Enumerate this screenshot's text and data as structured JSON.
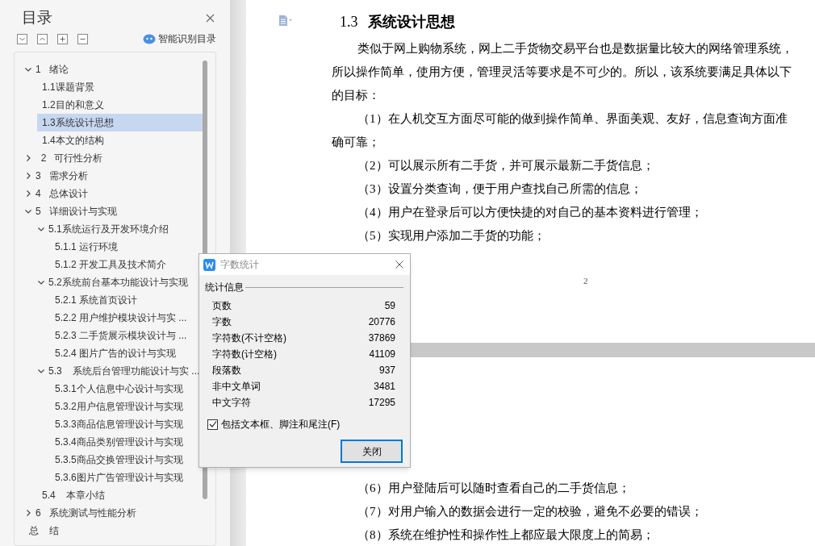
{
  "sidebar": {
    "title": "目录",
    "smart_toc": "智能识别目录",
    "toc": [
      {
        "kind": "branch",
        "label": "1   绪论",
        "expanded": true,
        "selected": false,
        "children": [
          {
            "kind": "leaf",
            "label": "1.1课题背景",
            "selected": false
          },
          {
            "kind": "leaf",
            "label": "1.2目的和意义",
            "selected": false
          },
          {
            "kind": "leaf",
            "label": "1.3系统设计思想",
            "selected": true
          },
          {
            "kind": "leaf",
            "label": "1.4本文的结构",
            "selected": false
          }
        ]
      },
      {
        "kind": "branch",
        "label": "  2   可行性分析",
        "expanded": false,
        "selected": false
      },
      {
        "kind": "branch",
        "label": "3   需求分析",
        "expanded": false,
        "selected": false
      },
      {
        "kind": "branch",
        "label": "4   总体设计",
        "expanded": false,
        "selected": false
      },
      {
        "kind": "branch",
        "label": "5   详细设计与实现",
        "expanded": true,
        "selected": false,
        "children": [
          {
            "kind": "branch",
            "label": "5.1系统运行及开发环境介绍",
            "expanded": true,
            "selected": false,
            "children": [
              {
                "kind": "leaf",
                "label": "5.1.1 运行环境",
                "selected": false
              },
              {
                "kind": "leaf",
                "label": "5.1.2 开发工具及技术简介",
                "selected": false
              }
            ]
          },
          {
            "kind": "branch",
            "label": "5.2系统前台基本功能设计与实现",
            "expanded": true,
            "selected": false,
            "children": [
              {
                "kind": "leaf",
                "label": "5.2.1 系统首页设计",
                "selected": false
              },
              {
                "kind": "leaf",
                "label": "5.2.2 用户维护模块设计与实 ...",
                "selected": false
              },
              {
                "kind": "leaf",
                "label": "5.2.3 二手货展示模块设计与 ...",
                "selected": false
              },
              {
                "kind": "leaf",
                "label": "5.2.4 图片广告的设计与实现",
                "selected": false
              }
            ]
          },
          {
            "kind": "branch",
            "label": "5.3    系统后台管理功能设计与实 ...",
            "expanded": true,
            "selected": false,
            "children": [
              {
                "kind": "leaf",
                "label": "5.3.1个人信息中心设计与实现",
                "selected": false
              },
              {
                "kind": "leaf",
                "label": "5.3.2用户信息管理设计与实现",
                "selected": false
              },
              {
                "kind": "leaf",
                "label": "5.3.3商品信息管理设计与实现",
                "selected": false
              },
              {
                "kind": "leaf",
                "label": "5.3.4商品类别管理设计与实现",
                "selected": false
              },
              {
                "kind": "leaf",
                "label": "5.3.5商品交换管理设计与实现",
                "selected": false
              },
              {
                "kind": "leaf",
                "label": "5.3.6图片广告管理设计与实现",
                "selected": false
              }
            ]
          },
          {
            "kind": "leaf",
            "label": "5.4    本章小结",
            "selected": false
          }
        ]
      },
      {
        "kind": "branch",
        "label": "6   系统测试与性能分析",
        "expanded": false,
        "selected": false
      },
      {
        "kind": "leaf",
        "label": "总    结",
        "selected": false
      }
    ]
  },
  "document": {
    "heading_number": "1.3",
    "heading_title": "系统设计思想",
    "page1_lines": [
      {
        "kind": "indented",
        "text": "类似于网上购物系统，网上二手货物交易平台也是数据量比较大的网络管理系统，"
      },
      {
        "kind": "flush",
        "text": "所以操作简单，使用方便，管理灵活等要求是不可少的。所以，该系统要满足具体以下"
      },
      {
        "kind": "flush",
        "text": "的目标："
      },
      {
        "kind": "indented",
        "text": "（1）在人机交互方面尽可能的做到操作简单、界面美观、友好，信息查询方面准"
      },
      {
        "kind": "flush",
        "text": "确可靠；"
      },
      {
        "kind": "indented",
        "text": "（2）可以展示所有二手货，并可展示最新二手货信息；"
      },
      {
        "kind": "indented",
        "text": "（3）设置分类查询，便于用户查找自己所需的信息；"
      },
      {
        "kind": "indented",
        "text": "（4）用户在登录后可以方便快捷的对自己的基本资料进行管理；"
      },
      {
        "kind": "indented",
        "text": "（5）实现用户添加二手货的功能；"
      }
    ],
    "page_number": "2",
    "page2_lines": [
      {
        "kind": "indented",
        "text": "（6）用户登陆后可以随时查看自己的二手货信息；"
      },
      {
        "kind": "indented",
        "text": "（7）对用户输入的数据会进行一定的校验，避免不必要的错误；"
      },
      {
        "kind": "indented",
        "text": "（8）系统在维护性和操作性上都应最大限度上的简易；"
      }
    ]
  },
  "dialog": {
    "title": "字数统计",
    "group": "统计信息",
    "stats": [
      {
        "label": "页数",
        "value": "59"
      },
      {
        "label": "字数",
        "value": "20776"
      },
      {
        "label": "字符数(不计空格)",
        "value": "37869"
      },
      {
        "label": "字符数(计空格)",
        "value": "41109"
      },
      {
        "label": "段落数",
        "value": "937"
      },
      {
        "label": "非中文单词",
        "value": "3481"
      },
      {
        "label": "中文字符",
        "value": "17295"
      }
    ],
    "checkbox": {
      "label": "包括文本框、脚注和尾注(F)",
      "checked": true
    },
    "button": "关闭"
  }
}
